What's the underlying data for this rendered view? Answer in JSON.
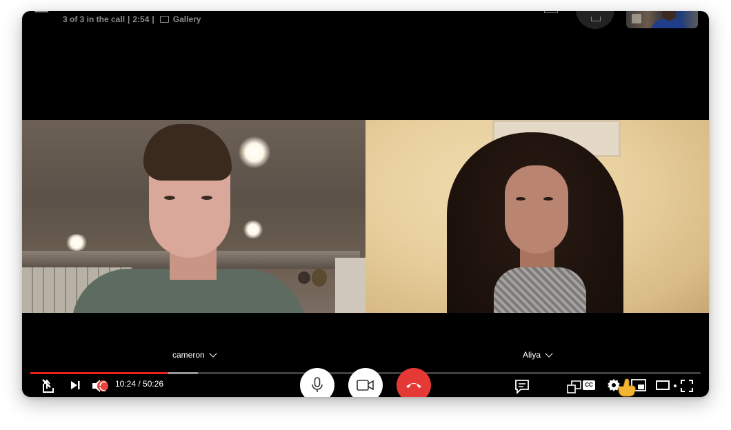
{
  "call_header": {
    "count": "3 of 3 in the call",
    "duration": "2:54",
    "view_mode": "Gallery"
  },
  "participants": [
    {
      "name": "cameron"
    },
    {
      "name": "Aliya"
    }
  ],
  "player": {
    "current_time": "10:24",
    "total_time": "50:26",
    "time_display": "10:24 / 50:26",
    "progress_fraction": 0.206,
    "buffered_fraction": 0.25
  },
  "icons": {
    "menu": "menu-icon",
    "gallery": "gallery-icon",
    "share": "share-icon",
    "next": "next-icon",
    "volume": "volume-icon",
    "mic": "microphone-icon",
    "camera": "video-camera-icon",
    "hangup": "phone-hangup-icon",
    "chat": "chat-icon",
    "pip": "picture-in-picture-icon",
    "cc": "CC",
    "settings": "gear-icon",
    "miniplayer": "miniplayer-icon",
    "theater": "theater-icon",
    "fullscreen": "fullscreen-icon"
  },
  "colors": {
    "played": "#e62117",
    "hangup": "#e53935",
    "background": "#000000"
  }
}
